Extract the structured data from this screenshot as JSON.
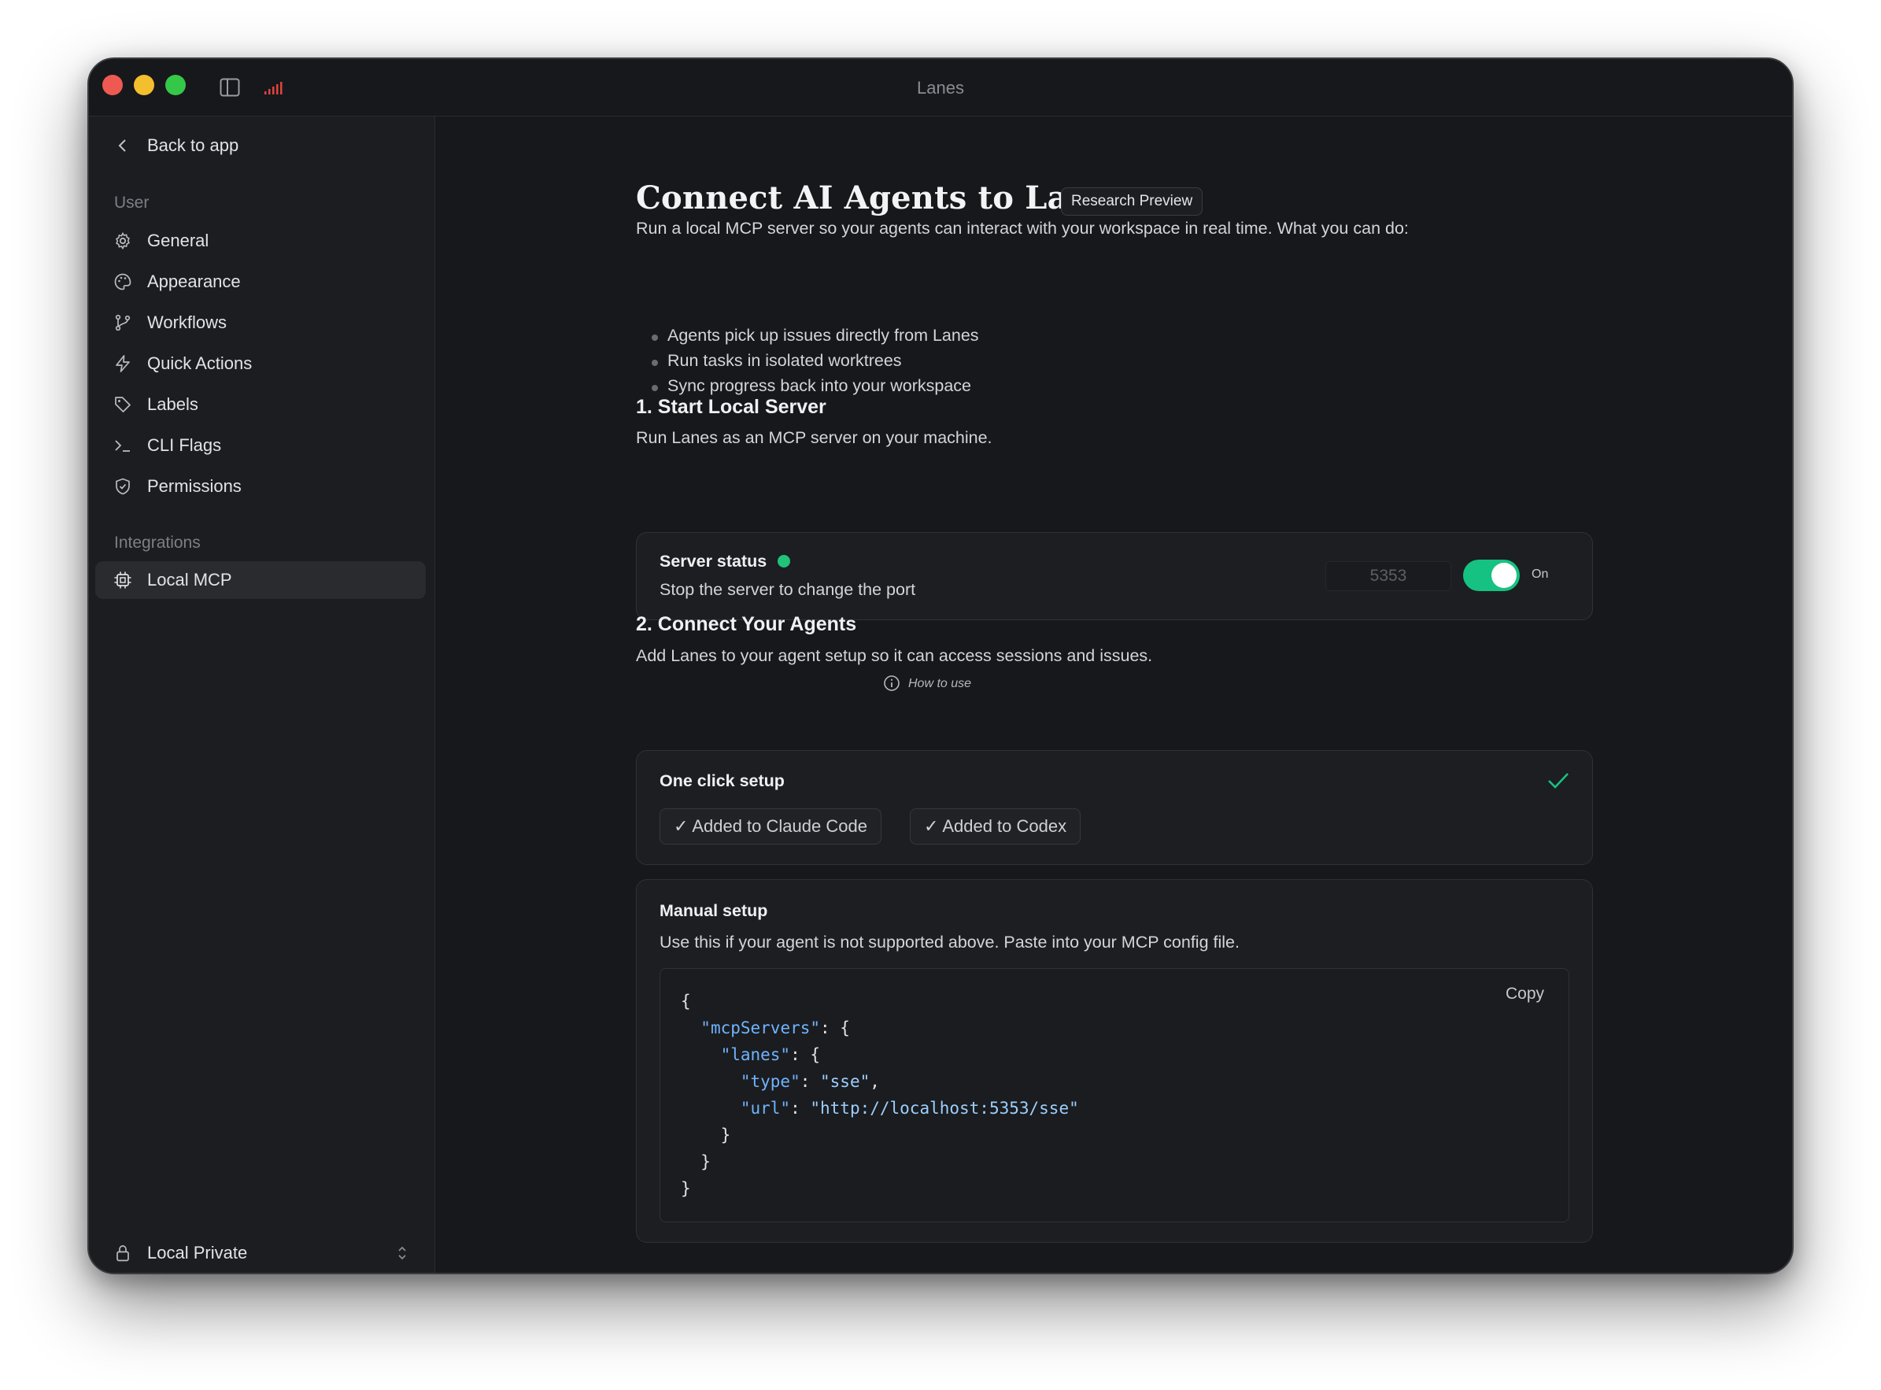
{
  "window": {
    "title": "Lanes"
  },
  "sidebar": {
    "back_label": "Back to app",
    "user_section": "User",
    "user_items": [
      {
        "label": "General",
        "icon": "gear-icon"
      },
      {
        "label": "Appearance",
        "icon": "palette-icon"
      },
      {
        "label": "Workflows",
        "icon": "branch-icon"
      },
      {
        "label": "Quick Actions",
        "icon": "lightning-icon"
      },
      {
        "label": "Labels",
        "icon": "tag-icon"
      },
      {
        "label": "CLI Flags",
        "icon": "terminal-icon"
      },
      {
        "label": "Permissions",
        "icon": "shield-icon"
      }
    ],
    "integrations_section": "Integrations",
    "integration_items": [
      {
        "label": "Local MCP",
        "icon": "chip-icon",
        "active": true
      }
    ],
    "workspace_label": "Local Private"
  },
  "main": {
    "title": "Connect AI Agents to Lanes",
    "badge": "Research Preview",
    "intro": "Run a local MCP server so your agents can interact with your workspace in real time. What you can do:",
    "bullets": [
      "Agents pick up issues directly from Lanes",
      "Run tasks in isolated worktrees",
      "Sync progress back into your workspace"
    ],
    "section1": {
      "title": "1. Start Local Server",
      "subtitle": "Run Lanes as an MCP server on your machine.",
      "status_title": "Server status",
      "status_desc": "Stop the server to change the port",
      "port": "5353",
      "toggle_label": "On",
      "toggle_on": true,
      "status_color": "#21c27a"
    },
    "section2": {
      "title": "2. Connect Your Agents",
      "how_to_use": "How to use",
      "subtitle": "Add Lanes to your agent setup so it can access sessions and issues.",
      "one_click_title": "One click setup",
      "claude_button": "✓ Added to Claude Code",
      "codex_button": "✓ Added to Codex",
      "manual_title": "Manual setup",
      "manual_desc": "Use this if your agent is not supported above. Paste into your MCP config file.",
      "copy_label": "Copy",
      "code": {
        "key_servers": "\"mcpServers\"",
        "key_lanes": "\"lanes\"",
        "key_type": "\"type\"",
        "val_type": "\"sse\"",
        "key_url": "\"url\"",
        "val_url": "\"http://localhost:5353/sse\""
      }
    }
  },
  "colors": {
    "accent_green": "#16c281",
    "code_key": "#6fb4ff"
  }
}
